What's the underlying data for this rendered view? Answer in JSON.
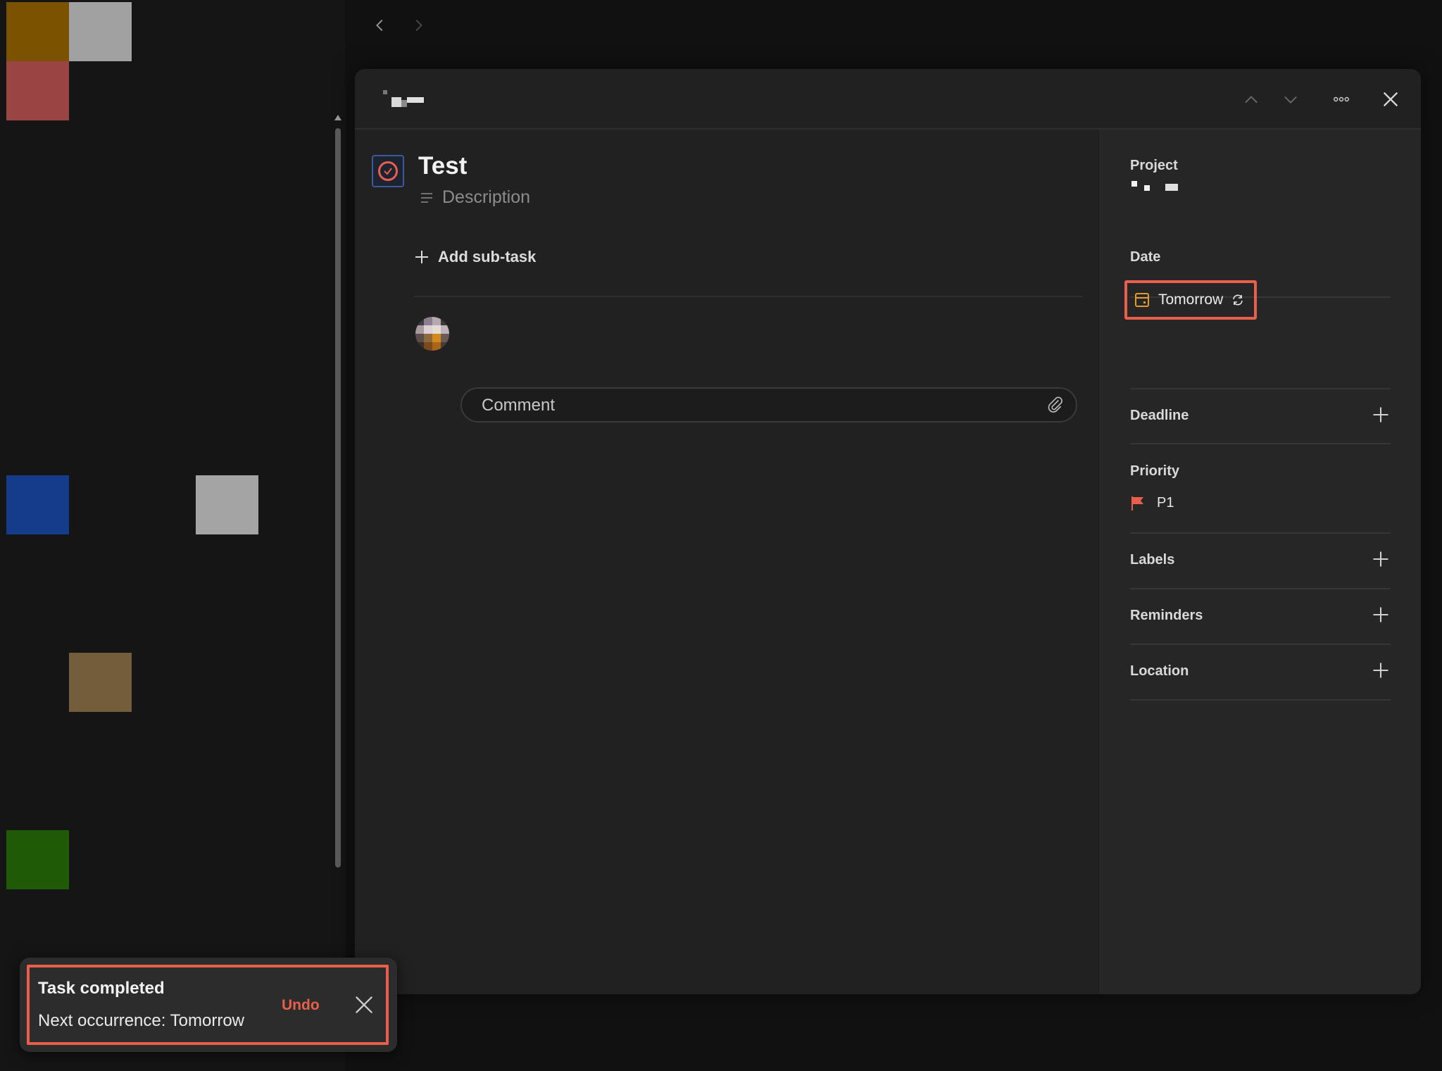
{
  "colors": {
    "accent": "#e8604c",
    "date_icon": "#e39b2c",
    "panel_bg": "#212121",
    "sidebar_bg": "#262626",
    "app_bg": "#111111"
  },
  "background_tiles": [
    {
      "color": "#7a5200"
    },
    {
      "color": "#a1a1a1"
    },
    {
      "color": "#9a4444"
    },
    {
      "color": "#153c8a"
    },
    {
      "color": "#a4a4a4"
    },
    {
      "color": "#735d3a"
    },
    {
      "color": "#1f5a07"
    }
  ],
  "nav": {
    "back_icon": "chevron-left-icon",
    "forward_icon": "chevron-right-icon"
  },
  "task": {
    "title": "Test",
    "description_placeholder": "Description",
    "add_subtask_label": "Add sub-task",
    "comment_placeholder": "Comment"
  },
  "sidebar": {
    "project_label": "Project",
    "date_label": "Date",
    "date_value": "Tomorrow",
    "deadline_label": "Deadline",
    "priority_label": "Priority",
    "priority_value": "P1",
    "labels_label": "Labels",
    "reminders_label": "Reminders",
    "location_label": "Location"
  },
  "toast": {
    "title": "Task completed",
    "message": "Next occurrence: Tomorrow",
    "undo_label": "Undo"
  }
}
